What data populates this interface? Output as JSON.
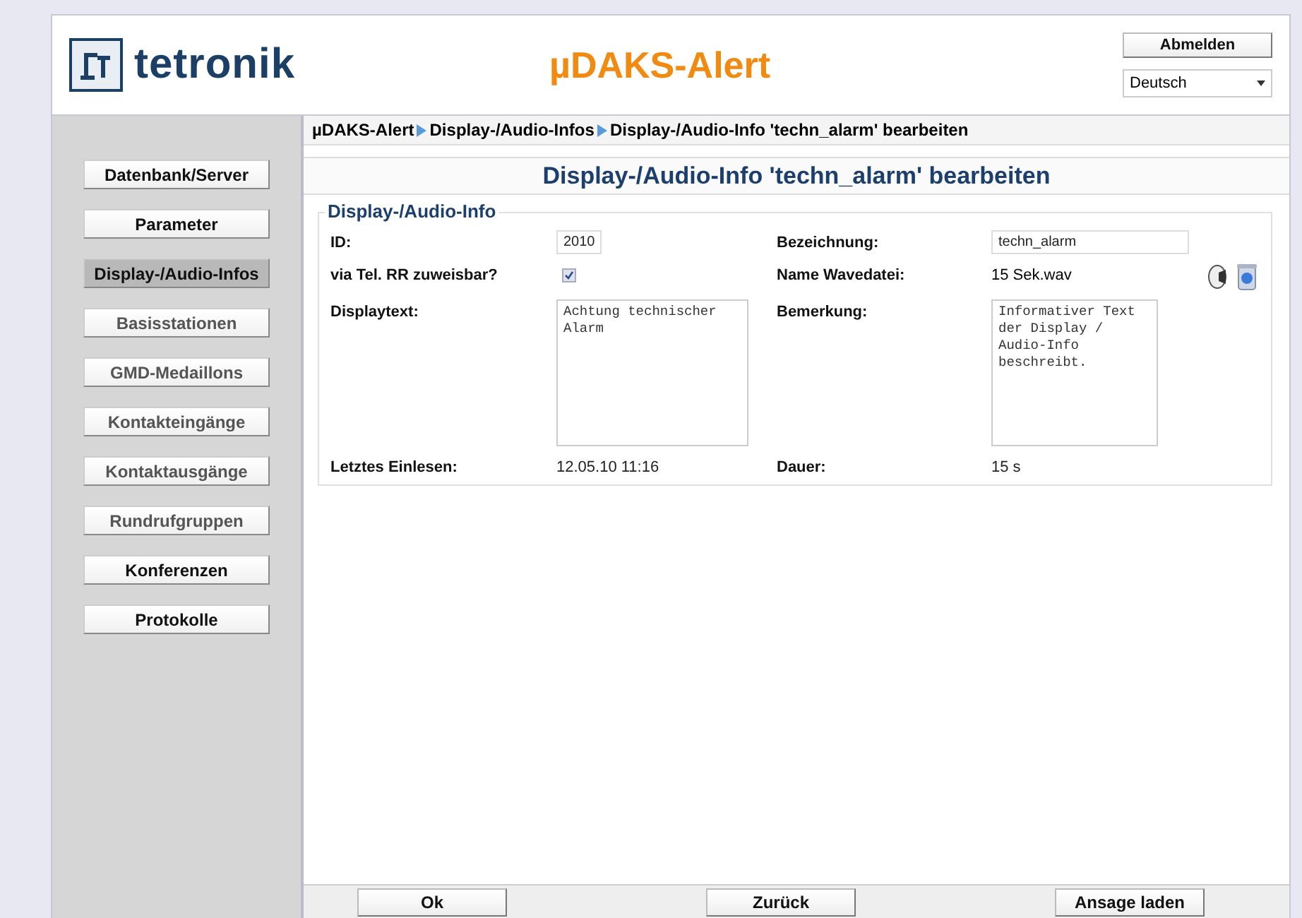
{
  "header": {
    "logo_text": "tetronik",
    "app_title": "µDAKS-Alert",
    "logout_button": "Abmelden",
    "language_select": {
      "value": "Deutsch"
    }
  },
  "sidebar": {
    "items": [
      {
        "label": "Datenbank/Server",
        "selected": false,
        "disabled": false
      },
      {
        "label": "Parameter",
        "selected": false,
        "disabled": false
      },
      {
        "label": "Display-/Audio-Infos",
        "selected": true,
        "disabled": false
      },
      {
        "label": "Basisstationen",
        "selected": false,
        "disabled": true
      },
      {
        "label": "GMD-Medaillons",
        "selected": false,
        "disabled": true
      },
      {
        "label": "Kontakteingänge",
        "selected": false,
        "disabled": true
      },
      {
        "label": "Kontaktausgänge",
        "selected": false,
        "disabled": true
      },
      {
        "label": "Rundrufgruppen",
        "selected": false,
        "disabled": true
      },
      {
        "label": "Konferenzen",
        "selected": false,
        "disabled": false
      },
      {
        "label": "Protokolle",
        "selected": false,
        "disabled": false
      }
    ]
  },
  "breadcrumb": [
    "µDAKS-Alert",
    "Display-/Audio-Infos",
    "Display-/Audio-Info 'techn_alarm' bearbeiten"
  ],
  "page_title": "Display-/Audio-Info 'techn_alarm' bearbeiten",
  "fieldset": {
    "legend": "Display-/Audio-Info",
    "fields": [
      {
        "label": "ID:",
        "kind": "input",
        "value": "2010"
      },
      {
        "label": "Bezeichnung:",
        "kind": "input",
        "value": "techn_alarm"
      },
      {
        "label": "via Tel. RR zuweisbar?",
        "kind": "checkbox",
        "checked": true
      },
      {
        "label": "Name Wavedatei:",
        "kind": "file",
        "value": "15 Sek.wav"
      },
      {
        "label": "Displaytext:",
        "kind": "textarea",
        "value": "Achtung technischer Alarm"
      },
      {
        "label": "Bemerkung:",
        "kind": "textarea",
        "value": "Informativer Text der Display / Audio-Info beschreibt."
      },
      {
        "label": "Letztes Einlesen:",
        "kind": "text",
        "value": "12.05.10 11:16"
      },
      {
        "label": "Dauer:",
        "kind": "text",
        "value": "15 s"
      }
    ]
  },
  "footer_buttons": [
    "Ok",
    "Zurück",
    "Ansage laden"
  ]
}
